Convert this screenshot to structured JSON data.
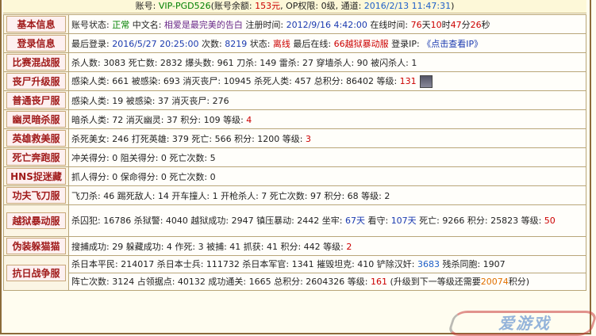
{
  "header": {
    "account_label": "账号: ",
    "account": "VIP-PGD526",
    "balance_label": "(账号余额: ",
    "balance": "153元",
    "op_label": ", OP权限: ",
    "op": "0级",
    "notice_label": ", 通道: ",
    "notice": "2016/2/13 11:47:31",
    "close": ")"
  },
  "rows": {
    "basic": {
      "category": "基本信息",
      "status_label": "账号状态: ",
      "status": "正常",
      "name_label": " 中文名: ",
      "name": "相爱是最完美的告白",
      "reg_label": " 注册时间: ",
      "reg": "2012/9/16 4:42:00",
      "online_label": " 在线时间: ",
      "online_days": "76",
      "online_days_unit": "天",
      "online_hours": "10",
      "online_hours_unit": "时",
      "online_min": "47",
      "online_min_unit": "分",
      "online_sec": "26",
      "online_sec_unit": "秒"
    },
    "login": {
      "category": "登录信息",
      "last_label": "最后登录: ",
      "last": "2016/5/27 20:25:00",
      "count_label": " 次数: ",
      "count": "8219",
      "state_label": " 状态: ",
      "state": "离线",
      "server_label": " 最后在线: ",
      "server": "66越狱暴动服",
      "ip_label": " 登录IP: ",
      "ip": "《点击查看IP》"
    },
    "mixed": {
      "category": "比赛混战服",
      "text": "杀人数: 3083 死亡数: 2832 爆头数: 961 刀杀: 149 雷杀: 27 穿墙杀人: 90 被闪杀人: 1"
    },
    "zombie": {
      "category": "丧尸升级服",
      "text": "感染人类: 661 被感染: 693 消灭丧尸: 10945 杀死人类: 457 总积分: 86402 等级: ",
      "level": "131"
    },
    "zombie_plain": {
      "category": "普通丧尸服",
      "text": "感染人类: 19 被感染: 37 消灭丧尸: 276"
    },
    "ghost": {
      "category": "幽灵暗杀服",
      "text": "暗杀人类: 72 消灭幽灵: 37 积分: 109 等级: ",
      "level": "4"
    },
    "hero": {
      "category": "英雄救美服",
      "text": "杀死美女: 246 打死英雄: 379 死亡: 566 积分: 1200 等级: ",
      "level": "3"
    },
    "deathrun": {
      "category": "死亡奔跑服",
      "text": "冲关得分: 0 阻关得分: 0 死亡次数: 5"
    },
    "hns": {
      "category": "HNS捉迷藏",
      "text": "抓人得分: 0 保命得分: 0 死亡次数: 0"
    },
    "kungfu": {
      "category": "功夫飞刀服",
      "text": "飞刀杀: 46 踢死敌人: 14 开车撞人: 1 开枪杀人: 7 死亡次数: 97 积分: 68 等级: 2"
    },
    "jailbreak": {
      "category": "越狱暴动服",
      "text_a": "杀囚犯: 16786 杀狱警: 4040 越狱成功: 2947 镇压暴动: 2442 坐牢: ",
      "jail_days": "67天",
      "text_b": " 看守: ",
      "guard_days": "107天",
      "text_c": " 死亡: 9266 积分: 25823 等级: ",
      "level": "50"
    },
    "catch": {
      "category": "伪装躲猫猫",
      "text": "搜捕成功: 29 躲藏成功: 4 作死: 3 被捕: 41 抓获: 41 积分: 442 等级: ",
      "level": "2"
    },
    "war": {
      "category": "抗日战争服",
      "line1_a": "杀日本平民: 214017 杀日本士兵: 111732 杀日本军官: 1341 摧毁坦克: 410 铲除汉奸: ",
      "traitors": "3683",
      "line1_b": " 残杀同胞: 1907",
      "line2_a": "阵亡次数: 3124 占领据点: 40132 成功通关: 1665 总积分: 2604326 等级: ",
      "level": "161",
      "line2_b": " (升级到下一等级还需要",
      "needed": "20074",
      "line2_c": "积分)"
    }
  },
  "watermark": {
    "text": "爱游戏"
  }
}
